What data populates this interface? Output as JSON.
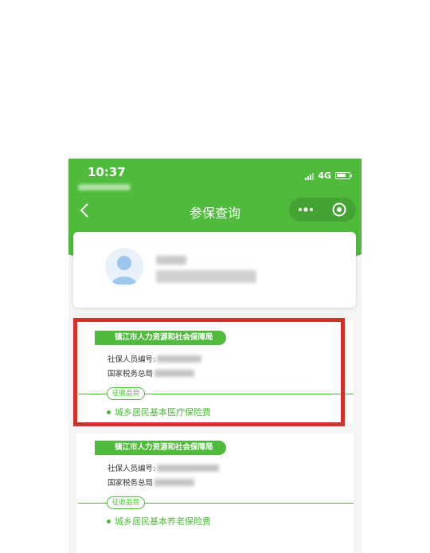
{
  "status_bar": {
    "time": "10:37",
    "network": "4G"
  },
  "nav": {
    "title": "参保查询"
  },
  "records": [
    {
      "bureau": "镇江市人力资源和社会保障局",
      "social_id_label": "社保人员编号:",
      "tax_bureau_label": "国家税务总局",
      "category_label": "征收品目",
      "item": "城乡居民基本医疗保险费"
    },
    {
      "bureau": "镇江市人力资源和社会保障局",
      "social_id_label": "社保人员编号:",
      "tax_bureau_label": "国家税务总局",
      "category_label": "征收品目",
      "item": "城乡居民基本养老保险费"
    }
  ],
  "colors": {
    "brand_green": "#4fba3c",
    "highlight_red": "#c9342c"
  },
  "icons": [
    "back-icon",
    "more-icon",
    "close-mini-program-icon",
    "avatar-icon",
    "signal-icon",
    "battery-icon"
  ]
}
